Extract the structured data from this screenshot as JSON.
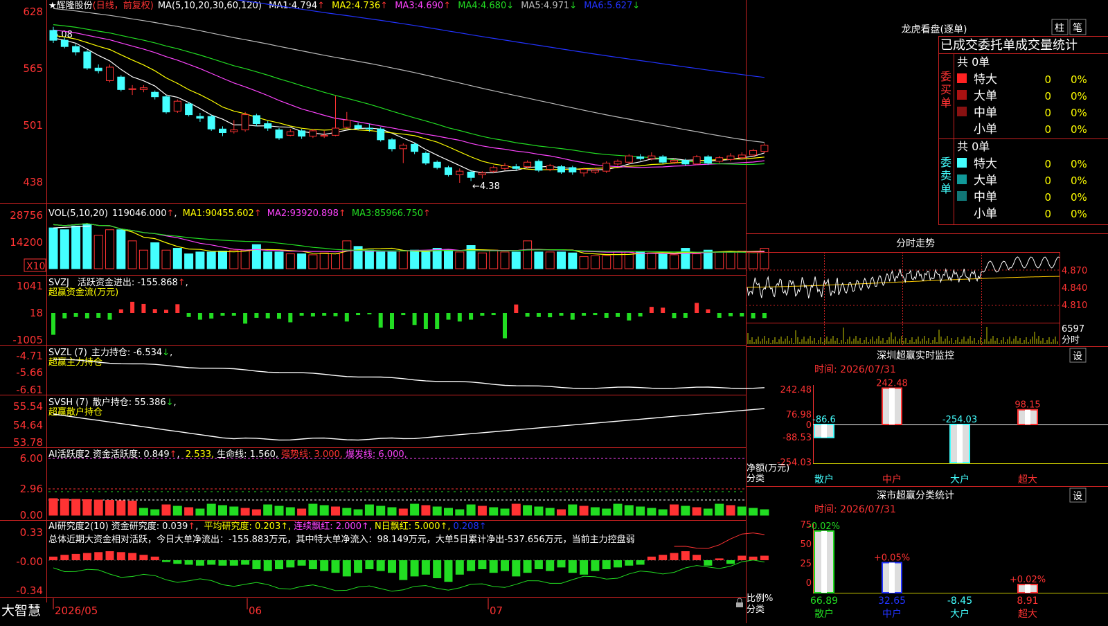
{
  "colors": {
    "up": "#ff3333",
    "down": "#44ffff",
    "ma1": "#ffffff",
    "ma2": "#ffff00",
    "ma3": "#ff44ff",
    "ma4": "#22dd22",
    "ma5": "#bbbbbb",
    "ma6": "#2233ff",
    "axis": "#ff3333",
    "purple": "#aa44ff"
  },
  "main": {
    "title_star": "★",
    "title_name": "辉隆股份",
    "title_mode": "(日线，前复权)",
    "ma_label": "MA(5,10,20,30,60,120)",
    "ma_items": [
      {
        "label": "MA1:",
        "value": "4.794",
        "arrow": "↑"
      },
      {
        "label": "MA2:",
        "value": "4.736",
        "arrow": "↑"
      },
      {
        "label": "MA3:",
        "value": "4.690",
        "arrow": "↑"
      },
      {
        "label": "MA4:",
        "value": "4.680",
        "arrow": "↓"
      },
      {
        "label": "MA5:",
        "value": "4.971",
        "arrow": "↓"
      },
      {
        "label": "MA6:",
        "value": "5.627",
        "arrow": "↓"
      }
    ],
    "y_ticks": [
      "628",
      "565",
      "501",
      "438"
    ],
    "high_mark": "6.08",
    "low_mark": "←4.38"
  },
  "vol": {
    "label": "VOL(5,10,20)",
    "value": "119046.000",
    "arrow": "↑",
    "ma_items": [
      {
        "label": "MA1:",
        "value": "90455.602",
        "arrow": "↑"
      },
      {
        "label": "MA2:",
        "value": "93920.898",
        "arrow": "↑"
      },
      {
        "label": "MA3:",
        "value": "85966.750",
        "arrow": "↑"
      }
    ],
    "y_ticks": [
      "28756",
      "14200"
    ],
    "unit": "X10"
  },
  "svzj": {
    "label": "SVZJ",
    "desc": "活跃资金进出:",
    "value": "-155.868",
    "arrow": "↑",
    "sep": ",",
    "sub": "超赢资金流(万元)",
    "y_ticks": [
      "1041",
      "18",
      "-1005"
    ]
  },
  "svzl": {
    "label": "SVZL (7)",
    "desc": "主力持仓:",
    "value": "-6.534",
    "arrow": "↓",
    "sep": ",",
    "sub": "超赢主力持仓",
    "y_ticks": [
      "-4.71",
      "-5.66",
      "-6.61"
    ]
  },
  "svsh": {
    "label": "SVSH (7)",
    "desc": "散户持仓:",
    "value": "55.386",
    "arrow": "↓",
    "sep": ",",
    "sub": "超赢散户持仓",
    "y_ticks": [
      "55.54",
      "54.64",
      "53.78"
    ]
  },
  "ai1": {
    "label": "AI活跃度2",
    "desc": "资金活跃度:",
    "value": "0.849",
    "arrow": "↑",
    "v2": "2.533,",
    "life": "生命线: 1.560,",
    "strong": "强势线: 3.000,",
    "burst": "爆发线: 6.000,",
    "y_ticks": [
      "6.00",
      "2.96",
      "0.00"
    ]
  },
  "ai2": {
    "label": "AI研究度2(10)",
    "desc": "资金研究度:",
    "value": "0.039",
    "arrow": "↑",
    "avg": "平均研究度: 0.203↑,",
    "cont": "连续飘红: 2.000↑,",
    "n": "N日飘红: 5.000↑,",
    "last": "0.208↑",
    "summary": "总体近期大资金相对活跃，今日大单净流出：-155.883万元，其中特大单净流入：98.149万元，大单5日累计净出-537.656万元，当前主力控盘弱",
    "y_ticks": [
      "0.33",
      "-0.00",
      "-0.34"
    ]
  },
  "xaxis": {
    "brand": "大智慧",
    "labels": [
      "2026/05",
      "06",
      "07"
    ]
  },
  "right": {
    "lhb_title": "龙虎看盘(逐单)",
    "btn_zhu": "柱",
    "btn_bi": "笔",
    "stat_title": "已成交委托单成交量统计",
    "buy": {
      "side": "委买单",
      "total": "共 0单",
      "rows": [
        {
          "label": "特大",
          "n": "0",
          "p": "0%"
        },
        {
          "label": "大单",
          "n": "0",
          "p": "0%"
        },
        {
          "label": "中单",
          "n": "0",
          "p": "0%"
        },
        {
          "label": "小单",
          "n": "0",
          "p": "0%"
        }
      ]
    },
    "sell": {
      "side": "委卖单",
      "total": "共 0单",
      "rows": [
        {
          "label": "特大",
          "n": "0",
          "p": "0%"
        },
        {
          "label": "大单",
          "n": "0",
          "p": "0%"
        },
        {
          "label": "中单",
          "n": "0",
          "p": "0%"
        },
        {
          "label": "小单",
          "n": "0",
          "p": "0%"
        }
      ]
    },
    "intraday": {
      "title": "分时走势",
      "y_ticks": [
        "4.870",
        "4.840",
        "4.810"
      ],
      "vol_tick": "6597",
      "vol_unit": "分时"
    },
    "monitor": {
      "title": "深圳超赢实时监控",
      "btn": "设",
      "time": "时间: 2026/07/31",
      "y_ticks": [
        "242.48",
        "76.98",
        "0",
        "-88.53",
        "-254.03"
      ],
      "ylabel1": "净额(万元)",
      "ylabel2": "分类",
      "cats": [
        "散户",
        "中户",
        "大户",
        "超大"
      ],
      "values": [
        -86.6,
        242.48,
        -254.03,
        98.15
      ],
      "value_labels": [
        "-86.6",
        "242.48",
        "-254.03",
        "98.15"
      ]
    },
    "stat": {
      "title": "深市超赢分类统计",
      "btn": "设",
      "time": "时间: 2026/07/31",
      "y_ticks": [
        "75",
        "50",
        "25",
        "0"
      ],
      "ylabel1": "比例%",
      "ylabel2": "分类",
      "cats": [
        "散户",
        "中户",
        "大户",
        "超大"
      ],
      "values": [
        66.89,
        32.65,
        -8.45,
        8.91
      ],
      "value_labels": [
        "66.89",
        "32.65",
        "-8.45",
        "8.91"
      ],
      "top_labels": [
        "-0.02%",
        "+0.05%",
        "",
        "+0.02%"
      ]
    }
  },
  "chart_data": [
    {
      "type": "candlestick",
      "title": "辉隆股份",
      "y_unit": "price",
      "ylim": [
        4.3,
        6.3
      ],
      "x_range": [
        "2026/05",
        "07"
      ],
      "candles": [
        {
          "o": 6.08,
          "c": 5.97,
          "h": 6.12,
          "l": 5.94
        },
        {
          "o": 5.97,
          "c": 5.9,
          "h": 6.0,
          "l": 5.88
        },
        {
          "o": 5.9,
          "c": 5.84,
          "h": 5.93,
          "l": 5.8
        },
        {
          "o": 5.84,
          "c": 5.66,
          "h": 5.86,
          "l": 5.64
        },
        {
          "o": 5.66,
          "c": 5.63,
          "h": 5.7,
          "l": 5.6
        },
        {
          "o": 5.52,
          "c": 5.67,
          "h": 5.7,
          "l": 5.5
        },
        {
          "o": 5.56,
          "c": 5.42,
          "h": 5.58,
          "l": 5.4
        },
        {
          "o": 5.42,
          "c": 5.43,
          "h": 5.47,
          "l": 5.36
        },
        {
          "o": 5.42,
          "c": 5.44,
          "h": 5.47,
          "l": 5.39
        },
        {
          "o": 5.39,
          "c": 5.34,
          "h": 5.41,
          "l": 5.31
        },
        {
          "o": 5.34,
          "c": 5.17,
          "h": 5.36,
          "l": 5.15
        },
        {
          "o": 5.18,
          "c": 5.29,
          "h": 5.31,
          "l": 5.16
        },
        {
          "o": 5.26,
          "c": 5.14,
          "h": 5.28,
          "l": 5.12
        },
        {
          "o": 5.12,
          "c": 5.1,
          "h": 5.16,
          "l": 5.06
        },
        {
          "o": 5.12,
          "c": 4.98,
          "h": 5.14,
          "l": 4.96
        },
        {
          "o": 4.98,
          "c": 4.94,
          "h": 5.01,
          "l": 4.9
        },
        {
          "o": 4.95,
          "c": 4.97,
          "h": 5.08,
          "l": 4.93
        },
        {
          "o": 4.97,
          "c": 5.14,
          "h": 5.17,
          "l": 4.95
        },
        {
          "o": 5.13,
          "c": 5.04,
          "h": 5.15,
          "l": 5.01
        },
        {
          "o": 5.04,
          "c": 4.99,
          "h": 5.07,
          "l": 4.96
        },
        {
          "o": 4.97,
          "c": 4.88,
          "h": 4.99,
          "l": 4.86
        },
        {
          "o": 4.91,
          "c": 4.95,
          "h": 4.98,
          "l": 4.9
        },
        {
          "o": 4.96,
          "c": 4.9,
          "h": 4.98,
          "l": 4.87
        },
        {
          "o": 4.9,
          "c": 4.96,
          "h": 4.98,
          "l": 4.88
        },
        {
          "o": 4.9,
          "c": 4.91,
          "h": 4.96,
          "l": 4.88
        },
        {
          "o": 4.91,
          "c": 4.99,
          "h": 5.35,
          "l": 4.9
        },
        {
          "o": 5.0,
          "c": 5.08,
          "h": 5.17,
          "l": 4.98
        },
        {
          "o": 5.02,
          "c": 4.99,
          "h": 5.05,
          "l": 4.97
        },
        {
          "o": 4.99,
          "c": 4.98,
          "h": 5.04,
          "l": 4.95
        },
        {
          "o": 4.98,
          "c": 4.86,
          "h": 5.0,
          "l": 4.84
        },
        {
          "o": 4.86,
          "c": 4.76,
          "h": 4.88,
          "l": 4.73
        },
        {
          "o": 4.76,
          "c": 4.8,
          "h": 4.82,
          "l": 4.6
        },
        {
          "o": 4.81,
          "c": 4.73,
          "h": 4.83,
          "l": 4.7
        },
        {
          "o": 4.71,
          "c": 4.6,
          "h": 4.73,
          "l": 4.58
        },
        {
          "o": 4.61,
          "c": 4.55,
          "h": 4.63,
          "l": 4.53
        },
        {
          "o": 4.55,
          "c": 4.47,
          "h": 4.57,
          "l": 4.45
        },
        {
          "o": 4.47,
          "c": 4.51,
          "h": 4.54,
          "l": 4.38
        },
        {
          "o": 4.5,
          "c": 4.44,
          "h": 4.52,
          "l": 4.4
        },
        {
          "o": 4.47,
          "c": 4.49,
          "h": 4.51,
          "l": 4.43
        },
        {
          "o": 4.51,
          "c": 4.55,
          "h": 4.57,
          "l": 4.49
        },
        {
          "o": 4.54,
          "c": 4.57,
          "h": 4.6,
          "l": 4.52
        },
        {
          "o": 4.56,
          "c": 4.54,
          "h": 4.59,
          "l": 4.52
        },
        {
          "o": 4.56,
          "c": 4.61,
          "h": 4.63,
          "l": 4.54
        },
        {
          "o": 4.62,
          "c": 4.52,
          "h": 4.64,
          "l": 4.5
        },
        {
          "o": 4.53,
          "c": 4.57,
          "h": 4.59,
          "l": 4.51
        },
        {
          "o": 4.56,
          "c": 4.5,
          "h": 4.58,
          "l": 4.48
        },
        {
          "o": 4.55,
          "c": 4.5,
          "h": 4.57,
          "l": 4.47
        },
        {
          "o": 4.49,
          "c": 4.53,
          "h": 4.55,
          "l": 4.45
        },
        {
          "o": 4.5,
          "c": 4.52,
          "h": 4.55,
          "l": 4.48
        },
        {
          "o": 4.51,
          "c": 4.6,
          "h": 4.62,
          "l": 4.49
        },
        {
          "o": 4.59,
          "c": 4.62,
          "h": 4.64,
          "l": 4.57
        },
        {
          "o": 4.61,
          "c": 4.68,
          "h": 4.7,
          "l": 4.59
        },
        {
          "o": 4.67,
          "c": 4.65,
          "h": 4.7,
          "l": 4.63
        },
        {
          "o": 4.65,
          "c": 4.68,
          "h": 4.72,
          "l": 4.63
        },
        {
          "o": 4.67,
          "c": 4.61,
          "h": 4.69,
          "l": 4.59
        },
        {
          "o": 4.61,
          "c": 4.63,
          "h": 4.65,
          "l": 4.59
        },
        {
          "o": 4.63,
          "c": 4.59,
          "h": 4.65,
          "l": 4.57
        },
        {
          "o": 4.59,
          "c": 4.67,
          "h": 4.69,
          "l": 4.58
        },
        {
          "o": 4.67,
          "c": 4.6,
          "h": 4.69,
          "l": 4.58
        },
        {
          "o": 4.62,
          "c": 4.66,
          "h": 4.68,
          "l": 4.6
        },
        {
          "o": 4.64,
          "c": 4.68,
          "h": 4.71,
          "l": 4.62
        },
        {
          "o": 4.66,
          "c": 4.69,
          "h": 4.72,
          "l": 4.64
        },
        {
          "o": 4.69,
          "c": 4.74,
          "h": 4.76,
          "l": 4.67
        },
        {
          "o": 4.73,
          "c": 4.8,
          "h": 4.82,
          "l": 4.71
        }
      ],
      "series": [
        {
          "name": "MA1"
        },
        {
          "name": "MA2"
        },
        {
          "name": "MA3"
        },
        {
          "name": "MA4"
        },
        {
          "name": "MA5"
        },
        {
          "name": "MA6"
        }
      ]
    },
    {
      "type": "bar",
      "title": "VOL(5,10,20)",
      "y_unit": "X10",
      "values": [
        22000,
        21000,
        23000,
        24000,
        18000,
        21000,
        21000,
        15000,
        10000,
        14000,
        10000,
        11000,
        8000,
        9000,
        9000,
        9500,
        10000,
        10000,
        13000,
        9000,
        9000,
        8000,
        8000,
        7500,
        8500,
        8000,
        15000,
        12000,
        10000,
        9000,
        9000,
        9500,
        10000,
        9000,
        11000,
        10000,
        9000,
        12500,
        8500,
        10000,
        9000,
        9000,
        15000,
        9000,
        9000,
        9000,
        8500,
        6500,
        7000,
        7000,
        9000,
        9000,
        9000,
        8500,
        8000,
        7500,
        11000,
        8000,
        10000,
        9000,
        9000,
        9500,
        9000,
        11000
      ],
      "up": [
        false,
        false,
        false,
        false,
        true,
        true,
        false,
        true,
        true,
        false,
        true,
        false,
        false,
        false,
        false,
        false,
        true,
        true,
        false,
        false,
        false,
        true,
        false,
        true,
        true,
        true,
        true,
        false,
        false,
        false,
        false,
        true,
        false,
        false,
        false,
        false,
        true,
        false,
        true,
        true,
        true,
        false,
        true,
        false,
        true,
        false,
        false,
        true,
        true,
        true,
        true,
        true,
        false,
        true,
        false,
        true,
        false,
        true,
        false,
        true,
        true,
        true,
        true,
        true
      ]
    },
    {
      "type": "bar",
      "title": "SVZJ",
      "y_unit": "万元",
      "ylim": [
        -1005,
        1041
      ],
      "values": [
        -820,
        -200,
        -150,
        -200,
        -180,
        -250,
        140,
        420,
        340,
        150,
        120,
        330,
        -150,
        -250,
        -210,
        -100,
        -100,
        -400,
        -180,
        -200,
        -220,
        -350,
        -100,
        -130,
        -100,
        -120,
        -320,
        -80,
        -50,
        -550,
        -600,
        -80,
        -450,
        -600,
        -600,
        -250,
        -320,
        -250,
        -100,
        -80,
        -950,
        320,
        -140,
        -150,
        -160,
        -100,
        -250,
        -100,
        -80,
        -180,
        -150,
        -280,
        -130,
        230,
        200,
        -190,
        -180,
        380,
        140,
        -180,
        -120,
        -130,
        -200,
        -190
      ]
    },
    {
      "type": "bar",
      "title": "深圳超赢实时监控",
      "categories": [
        "散户",
        "中户",
        "大户",
        "超大"
      ],
      "values": [
        -86.6,
        242.48,
        -254.03,
        98.15
      ],
      "ylim": [
        -254.03,
        242.48
      ]
    },
    {
      "type": "bar",
      "title": "深市超赢分类统计",
      "categories": [
        "散户",
        "中户",
        "大户",
        "超大"
      ],
      "values": [
        66.89,
        32.65,
        -8.45,
        8.91
      ],
      "ylim": [
        0,
        75
      ]
    }
  ]
}
